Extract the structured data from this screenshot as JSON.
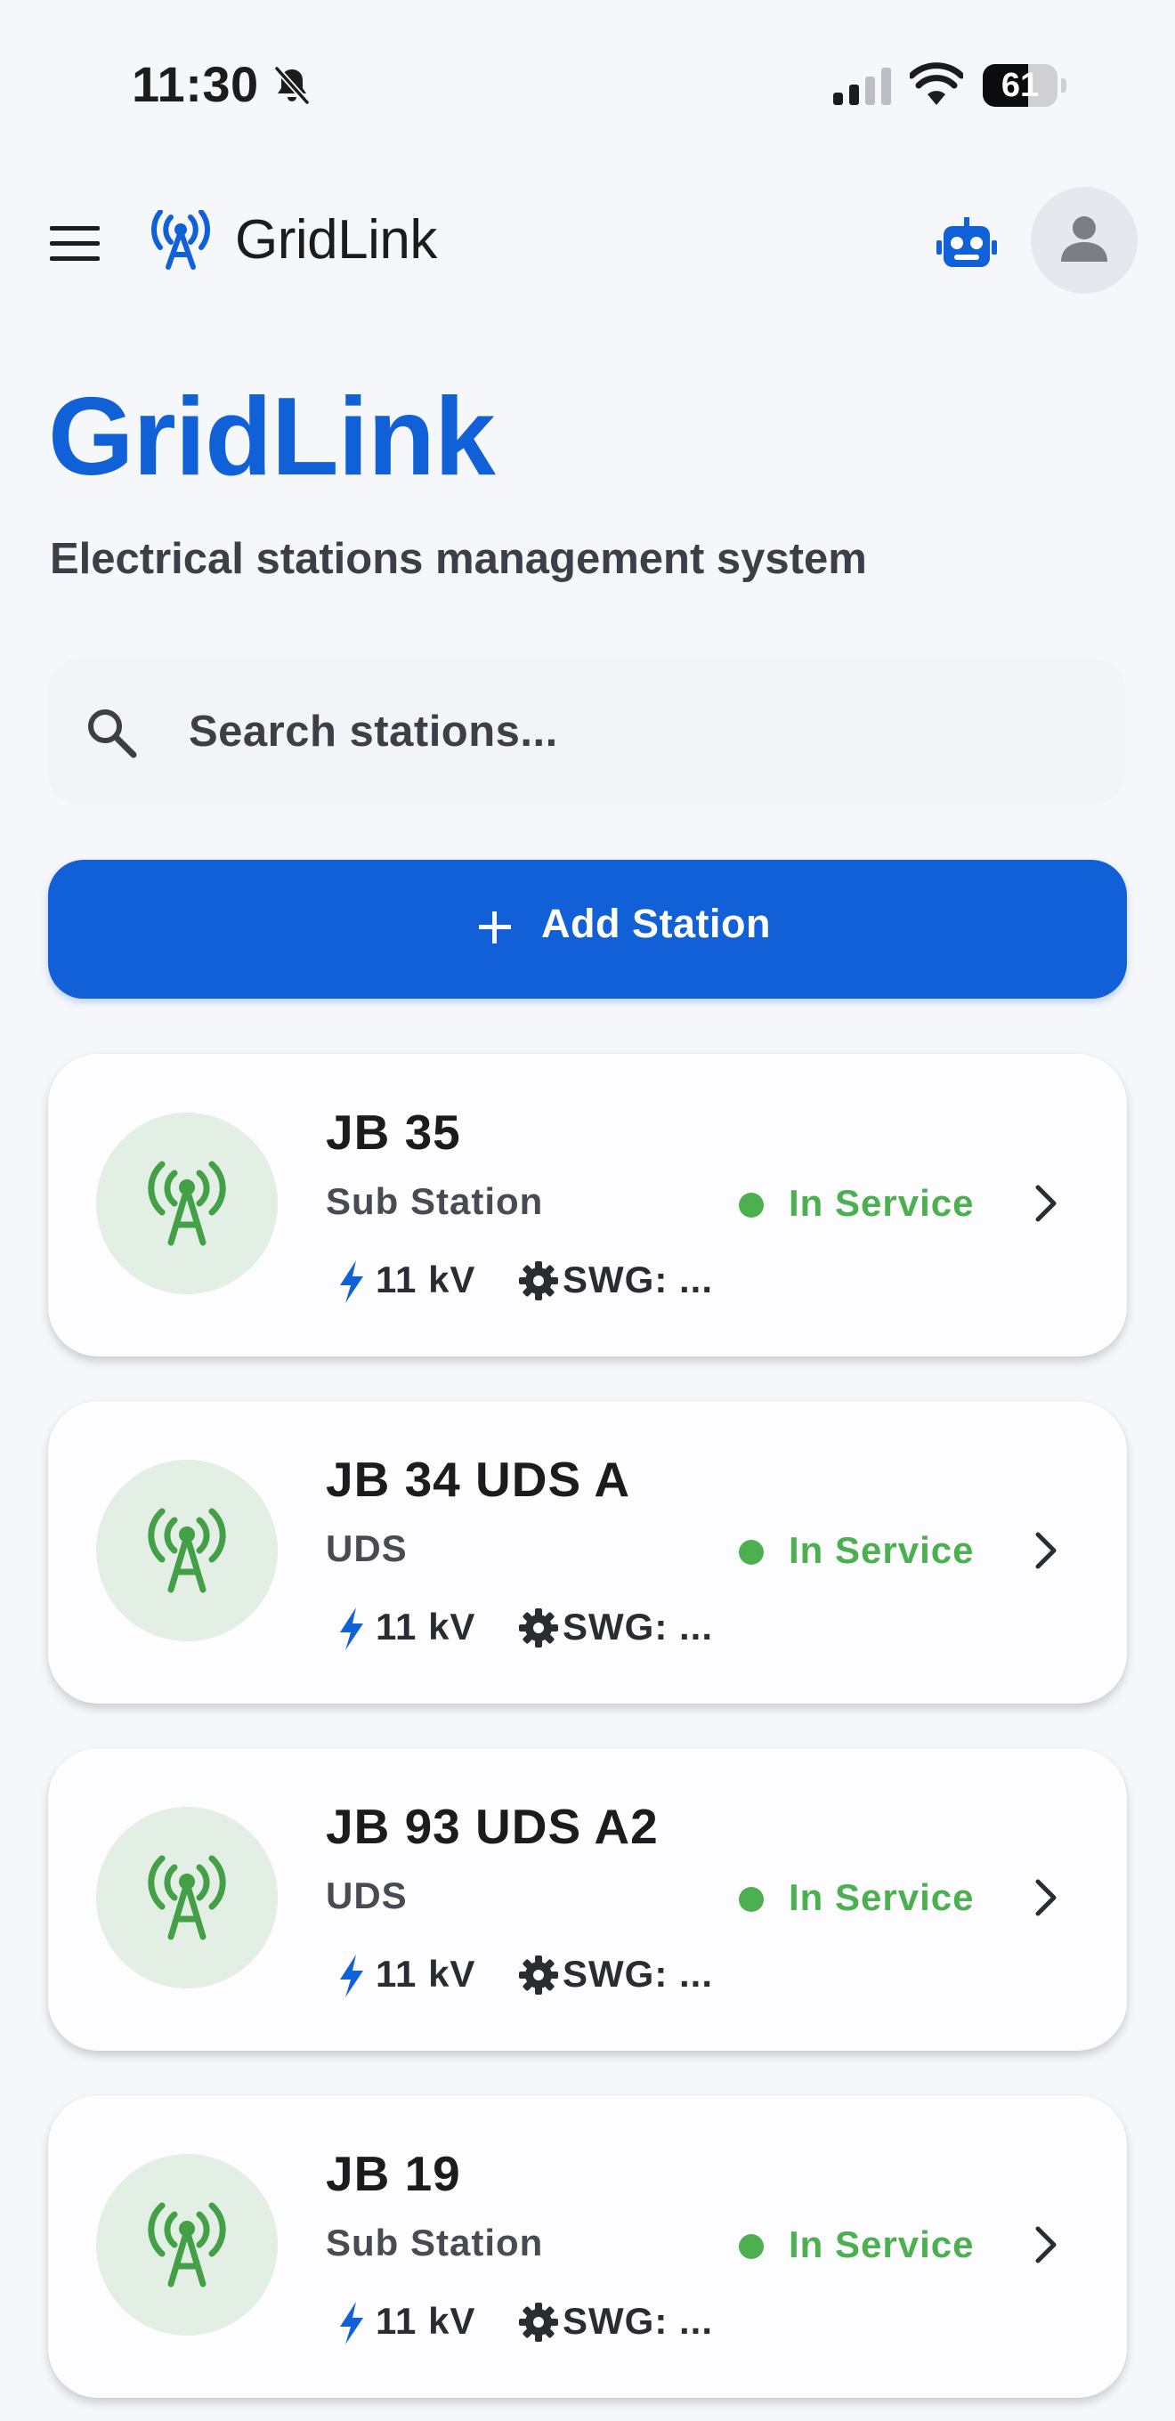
{
  "status_bar": {
    "time": "11:30",
    "battery_level": "61",
    "battery_fraction": 0.61,
    "icons": [
      "bell-slash-icon",
      "cellular-signal-icon",
      "wifi-icon",
      "battery-icon"
    ]
  },
  "app_bar": {
    "brand_name": "GridLink",
    "icons": [
      "menu-icon",
      "antenna-icon",
      "robot-icon",
      "account-icon"
    ]
  },
  "hero": {
    "title": "GridLink",
    "subtitle": "Electrical stations management system"
  },
  "search": {
    "placeholder": "Search stations..."
  },
  "add_button": {
    "label": "Add Station",
    "icon": "plus-icon"
  },
  "stations": [
    {
      "name": "JB 35",
      "type": "Sub Station",
      "voltage": "11 kV",
      "swg": "SWG: ...",
      "status": "In Service"
    },
    {
      "name": "JB 34 UDS A",
      "type": "UDS",
      "voltage": "11 kV",
      "swg": "SWG: ...",
      "status": "In Service"
    },
    {
      "name": "JB 93 UDS A2",
      "type": "UDS",
      "voltage": "11 kV",
      "swg": "SWG: ...",
      "status": "In Service"
    },
    {
      "name": "JB 19",
      "type": "Sub Station",
      "voltage": "11 kV",
      "swg": "SWG: ...",
      "status": "In Service"
    }
  ],
  "colors": {
    "brand_blue": "#1060d8",
    "status_green": "#4caf50",
    "background": "#f6f7fb",
    "card": "#fdfdff"
  }
}
